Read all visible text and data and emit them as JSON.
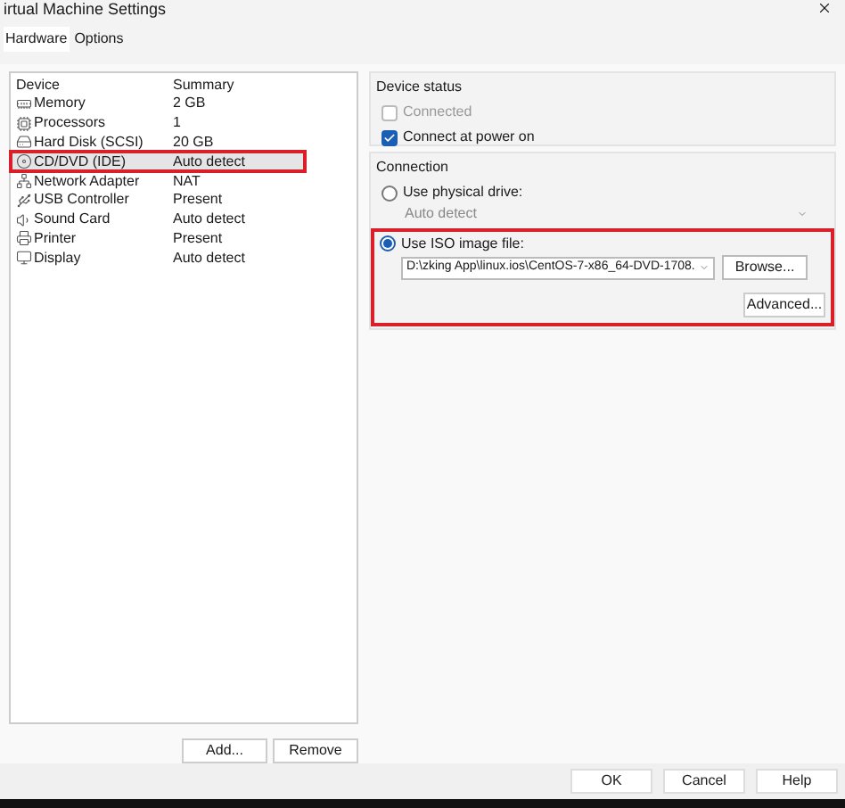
{
  "window": {
    "title": "irtual Machine Settings"
  },
  "tabs": [
    {
      "label": "Hardware",
      "selected": true
    },
    {
      "label": "Options",
      "selected": false
    }
  ],
  "devices": {
    "columns": [
      "Device",
      "Summary"
    ],
    "rows": [
      {
        "name": "Memory",
        "summary": "2 GB",
        "selected": false,
        "highlighted": false
      },
      {
        "name": "Processors",
        "summary": "1",
        "selected": false,
        "highlighted": false
      },
      {
        "name": "Hard Disk (SCSI)",
        "summary": "20 GB",
        "selected": false,
        "highlighted": false
      },
      {
        "name": "CD/DVD (IDE)",
        "summary": "Auto detect",
        "selected": true,
        "highlighted": true
      },
      {
        "name": "Network Adapter",
        "summary": "NAT",
        "selected": false,
        "highlighted": false
      },
      {
        "name": "USB Controller",
        "summary": "Present",
        "selected": false,
        "highlighted": false
      },
      {
        "name": "Sound Card",
        "summary": "Auto detect",
        "selected": false,
        "highlighted": false
      },
      {
        "name": "Printer",
        "summary": "Present",
        "selected": false,
        "highlighted": false
      },
      {
        "name": "Display",
        "summary": "Auto detect",
        "selected": false,
        "highlighted": false
      }
    ],
    "buttons": [
      "Add...",
      "Remove"
    ]
  },
  "device_status": {
    "title": "Device status",
    "options": [
      {
        "label": "Connected",
        "checked": false,
        "disabled": true
      },
      {
        "label": "Connect at power on",
        "checked": true,
        "disabled": false
      }
    ]
  },
  "connection": {
    "title": "Connection",
    "physical": {
      "label": "Use physical drive:",
      "selected": false,
      "value": "Auto detect"
    },
    "iso": {
      "label": "Use ISO image file:",
      "selected": true,
      "value": "D:\\zking App\\linux.ios\\CentOS-7-x86_64-DVD-1708.",
      "browse": "Browse...",
      "highlighted": true
    },
    "advanced": "Advanced..."
  },
  "footer_buttons": [
    "OK",
    "Cancel",
    "Help"
  ]
}
